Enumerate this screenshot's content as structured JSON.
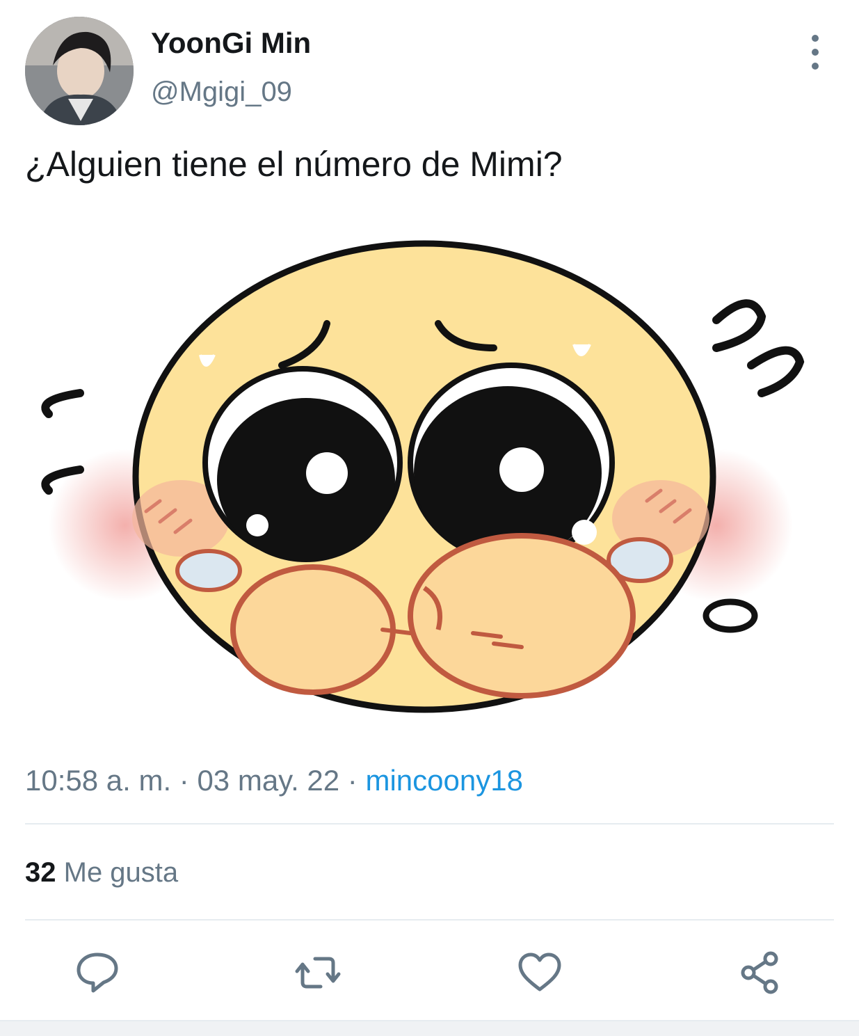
{
  "tweet": {
    "display_name": "YoonGi Min",
    "handle": "@Mgigi_09",
    "text": "¿Alguien tiene el número de Mimi?",
    "time": "10:58 a. m.",
    "date": "03 may. 22",
    "source": "mincoony18",
    "likes_count": "32",
    "likes_label": "Me gusta"
  },
  "icons": {
    "more": "vertical-ellipsis-icon",
    "reply": "speech-bubble-icon",
    "retweet": "retweet-arrows-icon",
    "like": "heart-icon",
    "share": "share-nodes-icon"
  },
  "colors": {
    "text": "#14171a",
    "secondary": "#657786",
    "link": "#1b95e0",
    "divider": "#e6ecf0"
  }
}
